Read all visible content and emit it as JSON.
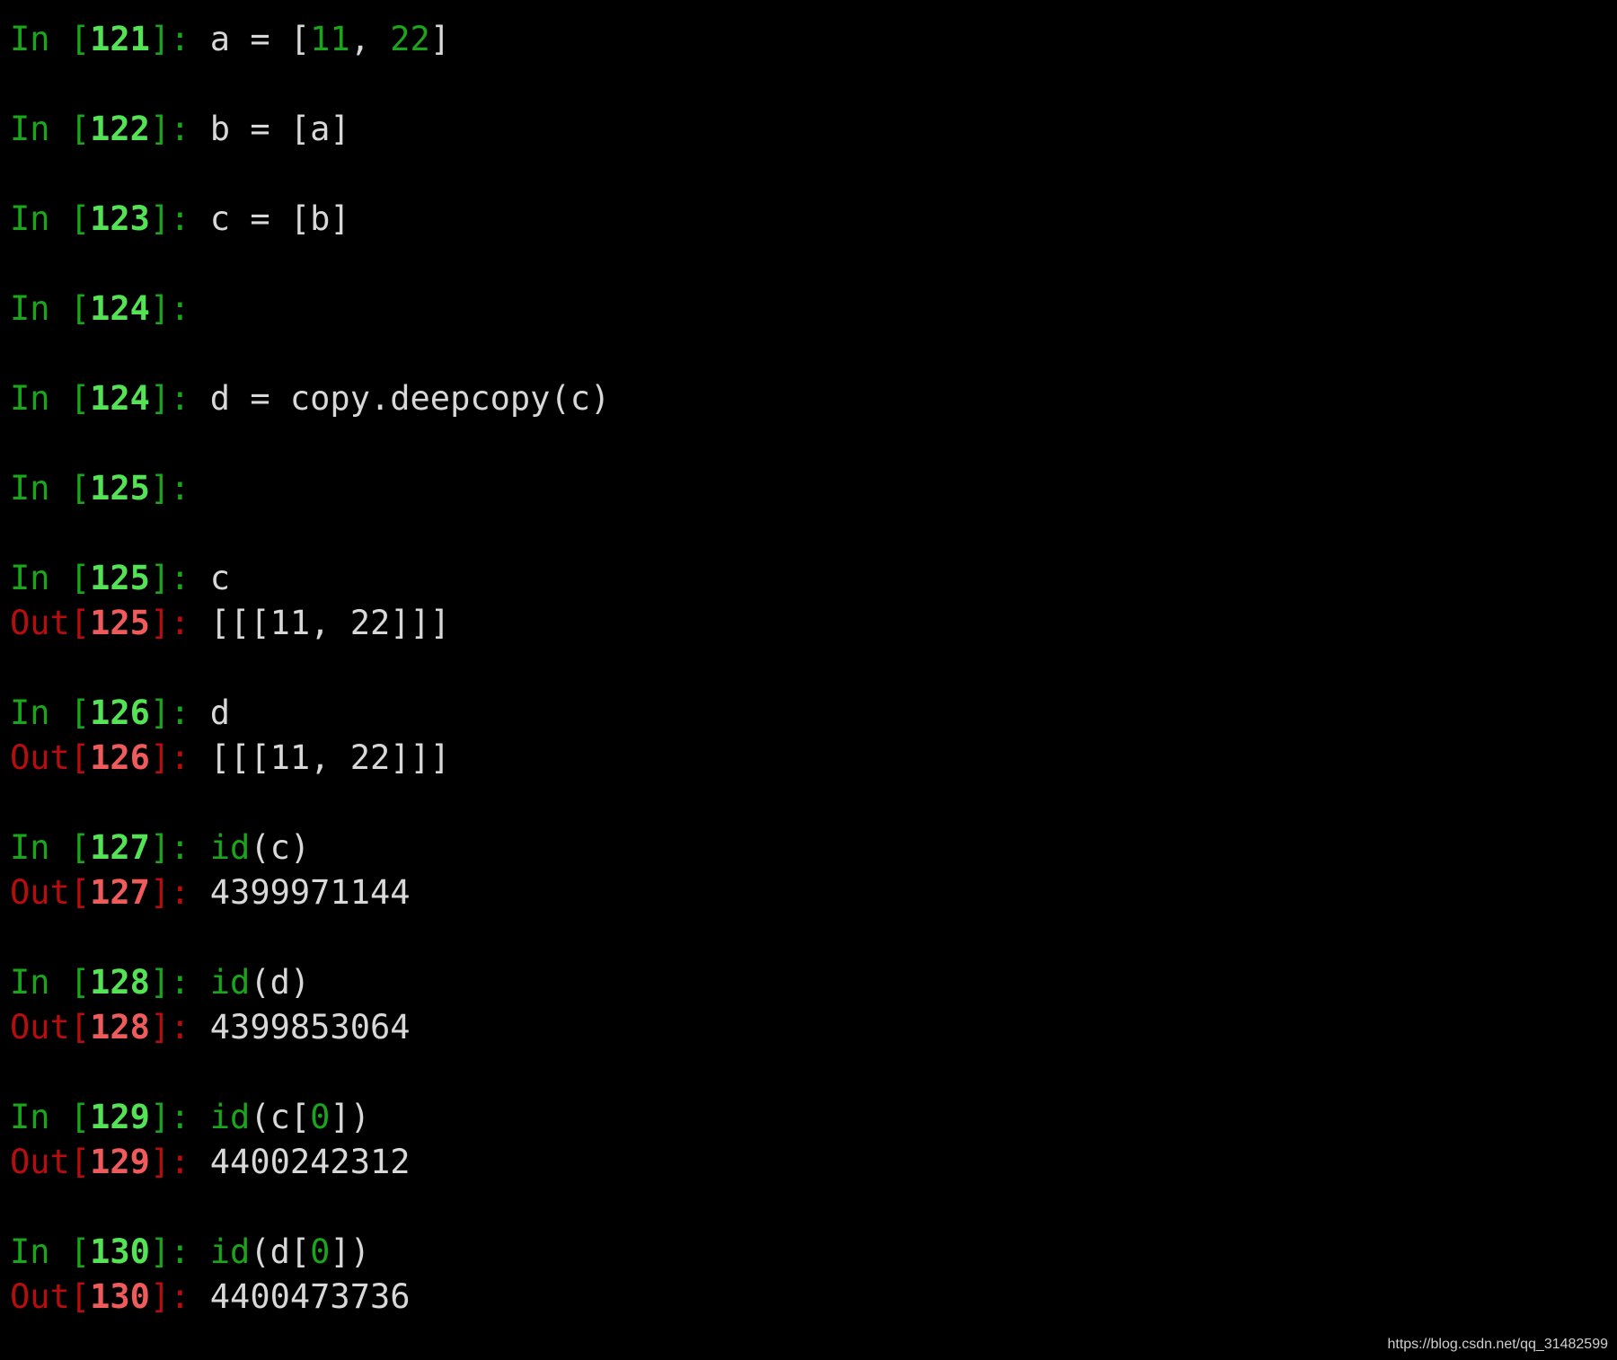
{
  "colors": {
    "background": "#000000",
    "in_prompt": "#1aa61a",
    "in_number": "#54e354",
    "out_prompt": "#b80d0d",
    "out_number": "#ef5a5a",
    "code_text": "#d8d8d8",
    "literal": "#1aa61a"
  },
  "session": {
    "prompts": {
      "in_open": "In [",
      "out_open": "Out[",
      "close": "]: "
    },
    "cells": [
      {
        "n": "121",
        "input": [
          {
            "t": "a = ["
          },
          {
            "t": "11",
            "k": "num"
          },
          {
            "t": ", "
          },
          {
            "t": "22",
            "k": "num"
          },
          {
            "t": "]"
          }
        ]
      },
      {
        "n": "122",
        "input": [
          {
            "t": "b = [a]"
          }
        ]
      },
      {
        "n": "123",
        "input": [
          {
            "t": "c = [b]"
          }
        ]
      },
      {
        "n": "124",
        "input": []
      },
      {
        "n": "124",
        "input": [
          {
            "t": "d = copy.deepcopy(c)"
          }
        ]
      },
      {
        "n": "125",
        "input": []
      },
      {
        "n": "125",
        "input": [
          {
            "t": "c"
          }
        ],
        "output": "[[[11, 22]]]"
      },
      {
        "n": "126",
        "input": [
          {
            "t": "d"
          }
        ],
        "output": "[[[11, 22]]]"
      },
      {
        "n": "127",
        "input": [
          {
            "t": "id",
            "k": "builtin"
          },
          {
            "t": "(c)"
          }
        ],
        "output": "4399971144"
      },
      {
        "n": "128",
        "input": [
          {
            "t": "id",
            "k": "builtin"
          },
          {
            "t": "(d)"
          }
        ],
        "output": "4399853064"
      },
      {
        "n": "129",
        "input": [
          {
            "t": "id",
            "k": "builtin"
          },
          {
            "t": "(c["
          },
          {
            "t": "0",
            "k": "num"
          },
          {
            "t": "])"
          }
        ],
        "output": "4400242312"
      },
      {
        "n": "130",
        "input": [
          {
            "t": "id",
            "k": "builtin"
          },
          {
            "t": "(d["
          },
          {
            "t": "0",
            "k": "num"
          },
          {
            "t": "])"
          }
        ],
        "output": "4400473736"
      }
    ]
  },
  "watermark": "https://blog.csdn.net/qq_31482599"
}
